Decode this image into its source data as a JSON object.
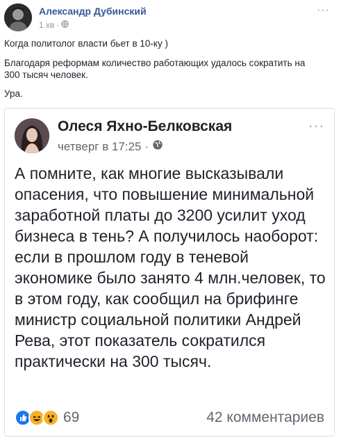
{
  "post": {
    "author": "Александр Дубинский",
    "time": "1 хв",
    "text_lines": [
      "Когда политолог власти бьет в 10-ку )",
      "Благодаря реформам количество работающих удалось сократить на",
      "300 тысяч человек.",
      "Ура."
    ]
  },
  "shared": {
    "author": "Олеся Яхно-Белковская",
    "time": "четверг в 17:25",
    "body": "А помните, как многие высказывали опасения, что повышение минимальной заработной платы до 3200 усилит уход бизнеса в тень? А получилось наоборот: если в прошлом году в теневой экономике было занято 4 млн.человек, то в этом году, как сообщил на брифинге министр социальной политики Андрей Рева, этот показатель сократился практически на 300 тысяч.",
    "reactions_count": "69",
    "comments": "42 комментариев",
    "reaction_icons": [
      "like-icon",
      "haha-icon",
      "wow-icon"
    ]
  },
  "colors": {
    "link": "#365899",
    "meta": "#90949c",
    "like": "#1877f2",
    "emoji": "#f7b125"
  }
}
